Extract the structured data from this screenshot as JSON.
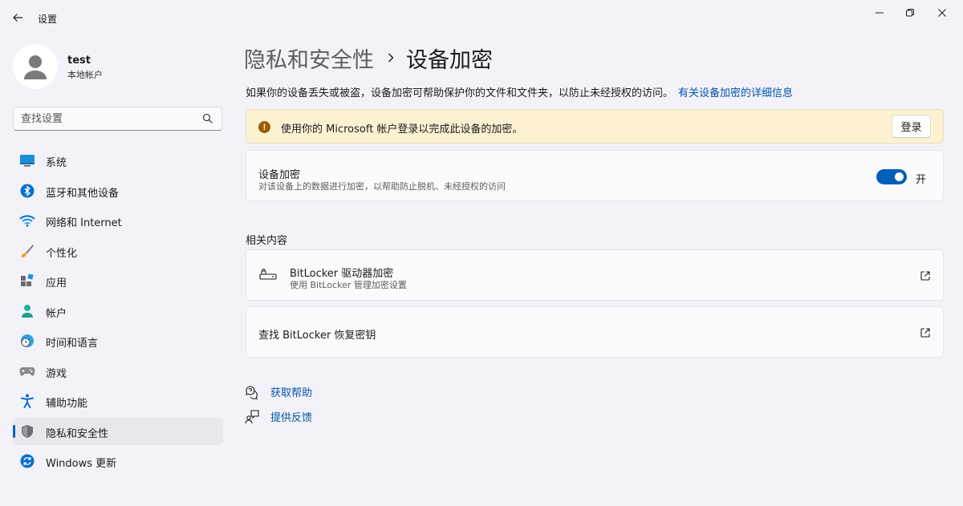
{
  "window": {
    "title": "设置"
  },
  "user": {
    "name": "test",
    "account_type": "本地帐户"
  },
  "search": {
    "placeholder": "查找设置"
  },
  "sidebar": {
    "items": [
      {
        "label": "系统",
        "icon": "system-icon"
      },
      {
        "label": "蓝牙和其他设备",
        "icon": "bluetooth-icon"
      },
      {
        "label": "网络和 Internet",
        "icon": "wifi-icon"
      },
      {
        "label": "个性化",
        "icon": "brush-icon"
      },
      {
        "label": "应用",
        "icon": "apps-icon"
      },
      {
        "label": "帐户",
        "icon": "account-icon"
      },
      {
        "label": "时间和语言",
        "icon": "time-language-icon"
      },
      {
        "label": "游戏",
        "icon": "gamepad-icon"
      },
      {
        "label": "辅助功能",
        "icon": "accessibility-icon"
      },
      {
        "label": "隐私和安全性",
        "icon": "shield-icon",
        "active": true
      },
      {
        "label": "Windows 更新",
        "icon": "update-icon"
      }
    ]
  },
  "breadcrumb": {
    "parent": "隐私和安全性",
    "current": "设备加密"
  },
  "intro": {
    "text": "如果你的设备丢失或被盗，设备加密可帮助保护你的文件和文件夹，以防止未经授权的访问。",
    "link": "有关设备加密的详细信息"
  },
  "warning": {
    "text": "使用你的 Microsoft 帐户登录以完成此设备的加密。",
    "button": "登录",
    "color": "#fcf2d2"
  },
  "encryption": {
    "title": "设备加密",
    "description": "对该设备上的数据进行加密，以帮助防止脱机、未经授权的访问",
    "toggle_state": "开",
    "toggle_on": true,
    "accent": "#005fb8"
  },
  "related": {
    "title": "相关内容",
    "bitlocker": {
      "title": "BitLocker 驱动器加密",
      "description": "使用 BitLocker 管理加密设置"
    },
    "recovery": {
      "title": "查找 BitLocker 恢复密钥"
    }
  },
  "help": {
    "get_help": "获取帮助",
    "feedback": "提供反馈"
  }
}
